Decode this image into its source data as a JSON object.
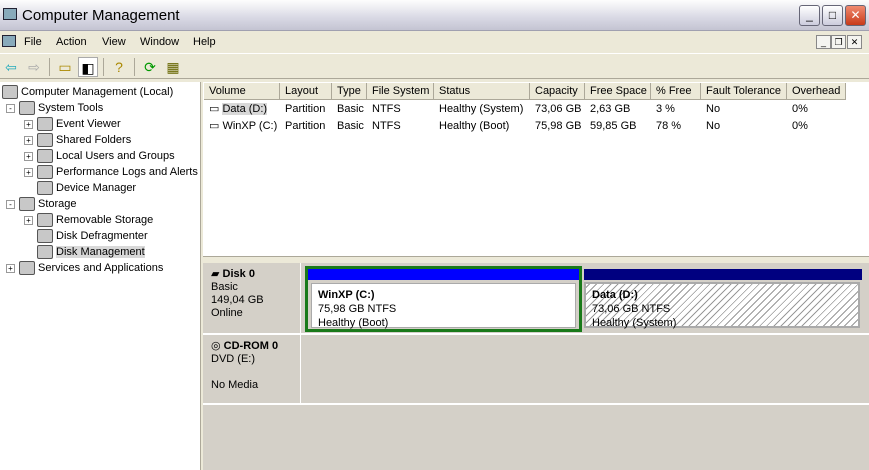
{
  "window": {
    "title": "Computer Management"
  },
  "menu": [
    "File",
    "Action",
    "View",
    "Window",
    "Help"
  ],
  "tree": [
    {
      "label": "Computer Management (Local)",
      "level": 0,
      "exp": ""
    },
    {
      "label": "System Tools",
      "level": 1,
      "exp": "-"
    },
    {
      "label": "Event Viewer",
      "level": 2,
      "exp": "+"
    },
    {
      "label": "Shared Folders",
      "level": 2,
      "exp": "+"
    },
    {
      "label": "Local Users and Groups",
      "level": 2,
      "exp": "+"
    },
    {
      "label": "Performance Logs and Alerts",
      "level": 2,
      "exp": "+"
    },
    {
      "label": "Device Manager",
      "level": 2,
      "exp": ""
    },
    {
      "label": "Storage",
      "level": 1,
      "exp": "-"
    },
    {
      "label": "Removable Storage",
      "level": 2,
      "exp": "+"
    },
    {
      "label": "Disk Defragmenter",
      "level": 2,
      "exp": ""
    },
    {
      "label": "Disk Management",
      "level": 2,
      "exp": "",
      "selected": true
    },
    {
      "label": "Services and Applications",
      "level": 1,
      "exp": "+"
    }
  ],
  "columns": [
    "Volume",
    "Layout",
    "Type",
    "File System",
    "Status",
    "Capacity",
    "Free Space",
    "% Free",
    "Fault Tolerance",
    "Overhead"
  ],
  "rows": [
    [
      "Data (D:)",
      "Partition",
      "Basic",
      "NTFS",
      "Healthy (System)",
      "73,06 GB",
      "2,63 GB",
      "3 %",
      "No",
      "0%"
    ],
    [
      "WinXP (C:)",
      "Partition",
      "Basic",
      "NTFS",
      "Healthy (Boot)",
      "75,98 GB",
      "59,85 GB",
      "78 %",
      "No",
      "0%"
    ]
  ],
  "disks": [
    {
      "name": "Disk 0",
      "lines": [
        "Basic",
        "149,04 GB",
        "Online"
      ],
      "partitions": [
        {
          "name": "WinXP  (C:)",
          "size": "75,98 GB NTFS",
          "status": "Healthy (Boot)"
        },
        {
          "name": "Data  (D:)",
          "size": "73,06 GB NTFS",
          "status": "Healthy (System)"
        }
      ]
    },
    {
      "name": "CD-ROM 0",
      "lines": [
        "DVD (E:)",
        "",
        "No Media"
      ]
    }
  ],
  "colors": {
    "primary": "#0000ff",
    "extended": "#000080",
    "selection": "#1a7a1a"
  }
}
